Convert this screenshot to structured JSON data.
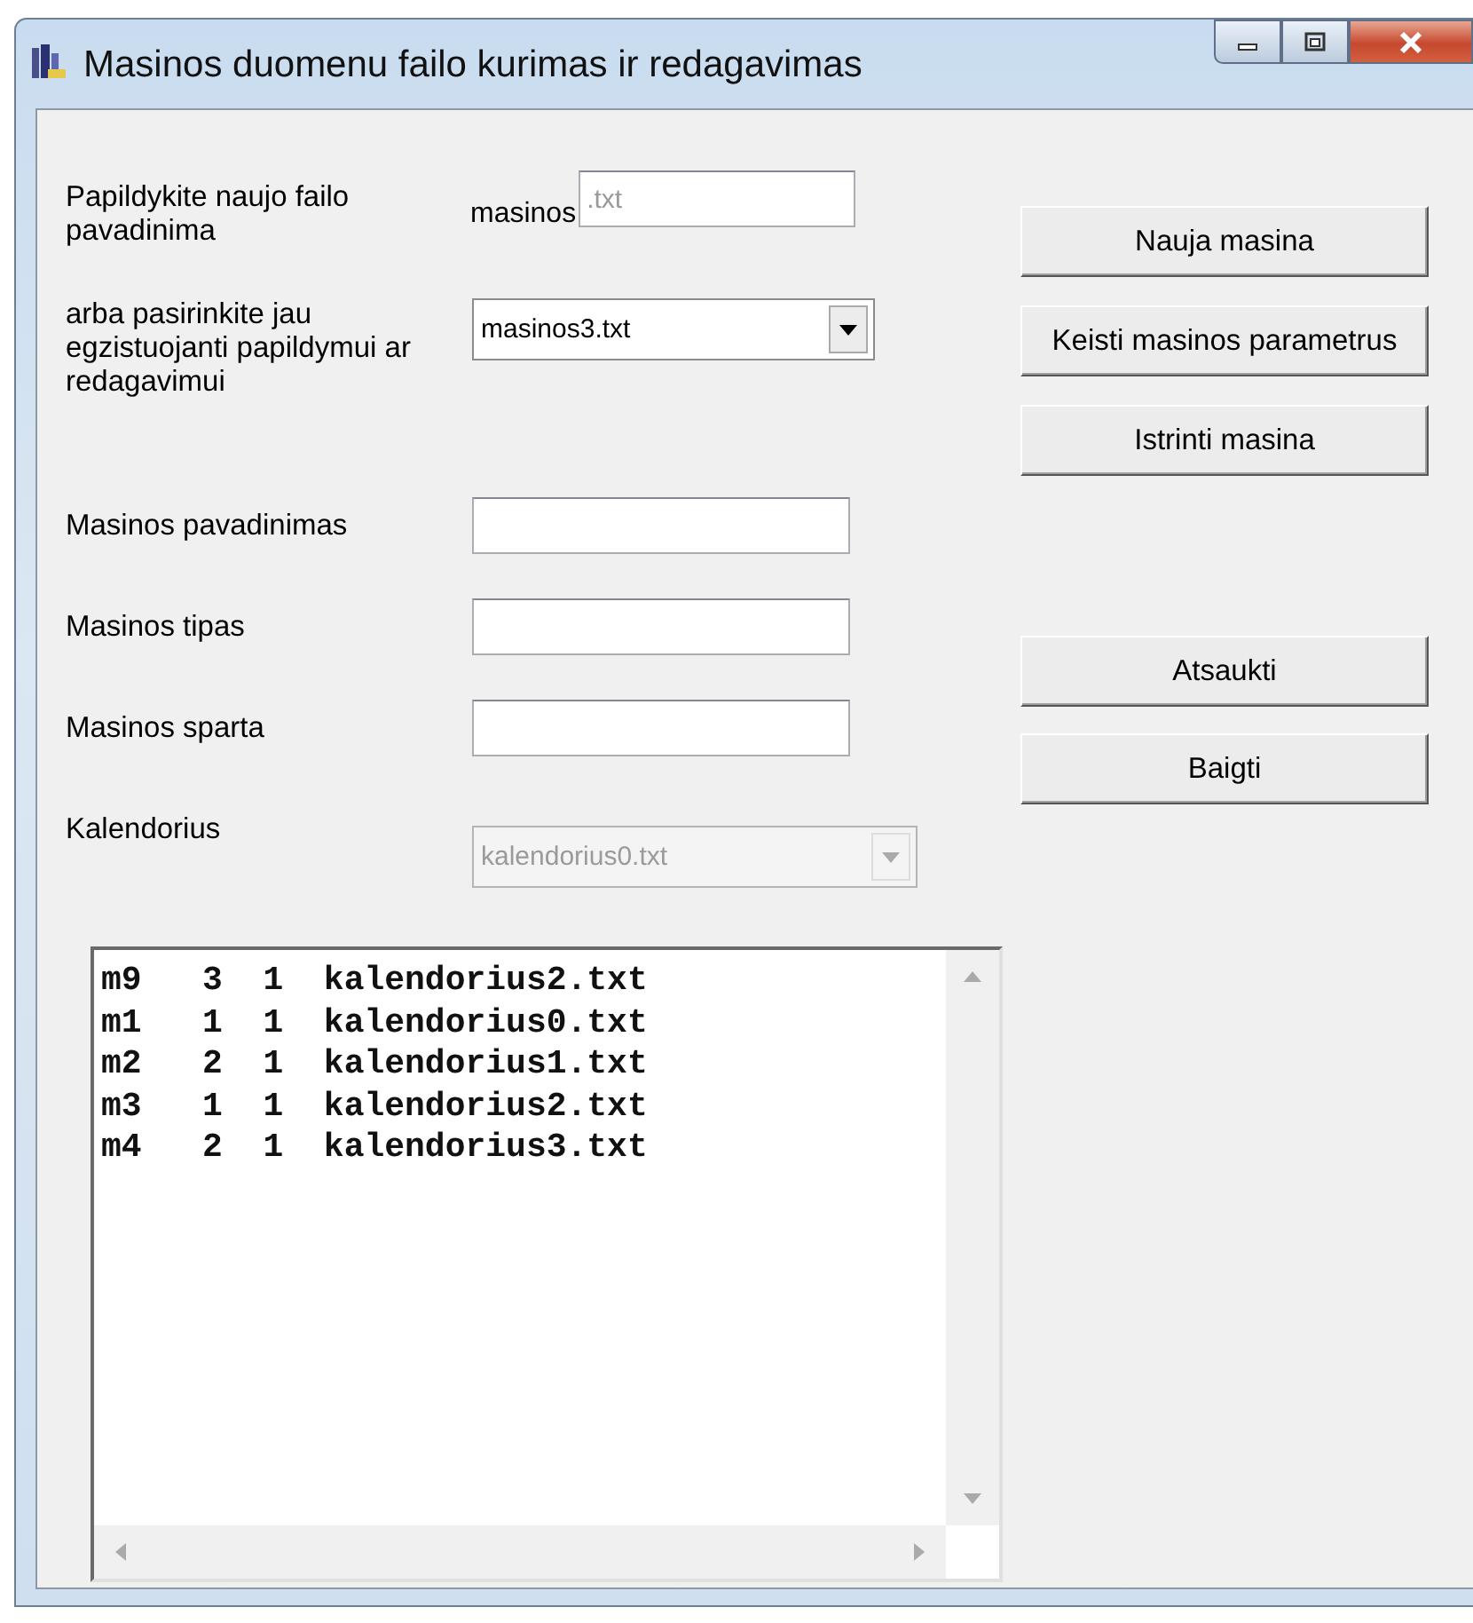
{
  "window": {
    "title": "Masinos duomenu failo kurimas ir redagavimas"
  },
  "new_file": {
    "label": "Papildykite naujo failo pavadinima",
    "prefix": "masinos",
    "placeholder": ".txt"
  },
  "existing_file": {
    "label": "arba pasirinkite jau egzistuojanti papildymui ar redagavimui",
    "value": "masinos3.txt"
  },
  "fields": [
    {
      "label": "Masinos pavadinimas"
    },
    {
      "label": "Masinos tipas"
    },
    {
      "label": "Masinos sparta"
    }
  ],
  "calendar": {
    "label": "Kalendorius",
    "value": "kalendorius0.txt",
    "disabled": true
  },
  "list": {
    "lines": [
      "m9   3  1  kalendorius2.txt",
      "m1   1  1  kalendorius0.txt",
      "m2   2  1  kalendorius1.txt",
      "m3   1  1  kalendorius2.txt",
      "m4   2  1  kalendorius3.txt"
    ]
  },
  "actions": [
    "Nauja masina",
    "Keisti masinos parametrus",
    "Istrinti masina"
  ],
  "dialog_buttons": [
    "Atsaukti",
    "Baigti"
  ]
}
